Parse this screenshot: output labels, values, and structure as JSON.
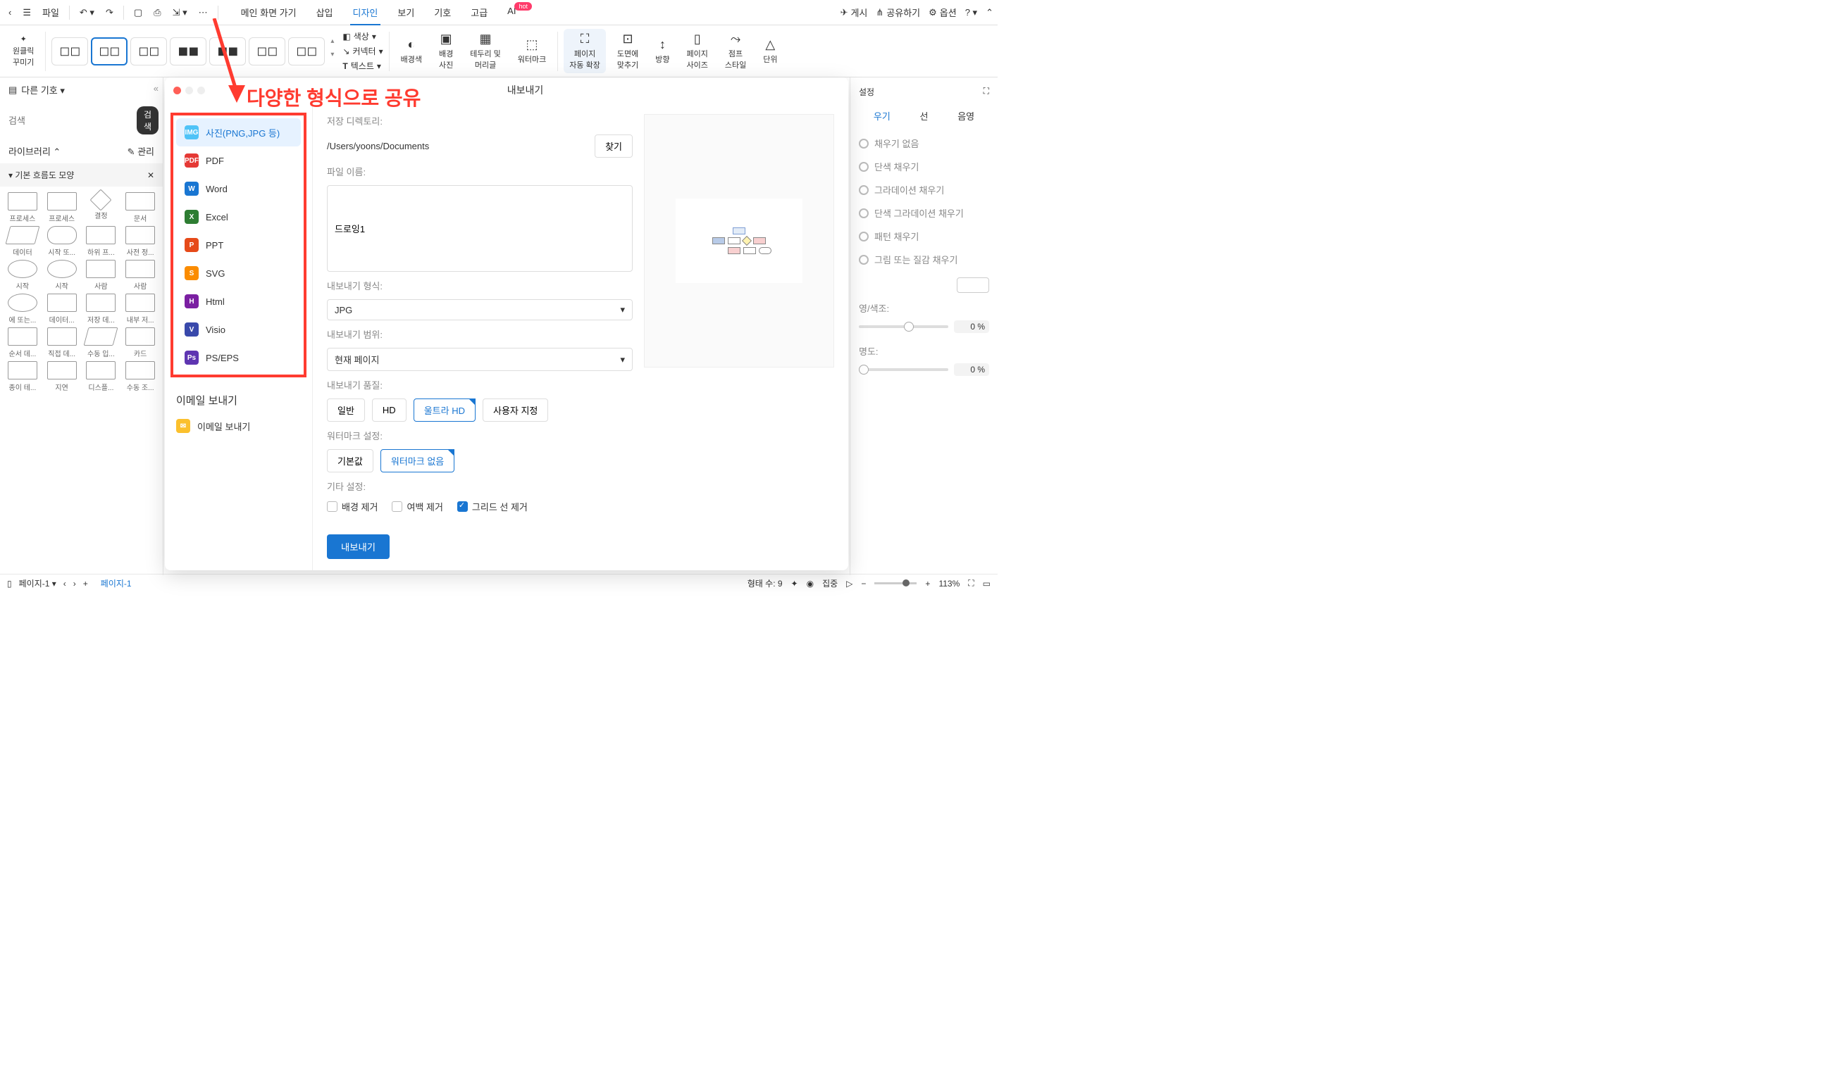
{
  "toolbar": {
    "file": "파일",
    "menus": [
      "메인 화면 가기",
      "삽입",
      "디자인",
      "보기",
      "기호",
      "고급",
      "AI"
    ],
    "active_menu": "디자인",
    "hot": "hot",
    "publish": "게시",
    "share": "공유하기",
    "options": "옵션"
  },
  "ribbon": {
    "oneclick": "원클릭\n꾸미기",
    "mini": {
      "color": "색상",
      "connector": "커넥터",
      "text": "텍스트"
    },
    "bgcolor": "배경색",
    "bgimage": "배경\n사진",
    "border_header": "테두리 및\n머리글",
    "watermark": "워터마크",
    "auto_expand": "페이지\n자동 확장",
    "fit_drawing": "도면에\n맞추기",
    "direction": "방향",
    "page_size": "페이지\n사이즈",
    "jump_style": "점프\n스타일",
    "unit": "단위"
  },
  "left_panel": {
    "other_symbols": "다른 기호",
    "search_ph": "검색",
    "search_btn": "검색",
    "library": "라이브러리",
    "manage": "관리",
    "section": "기본 흐름도 모양",
    "shapes": [
      "프로세스",
      "프로세스",
      "결정",
      "문서",
      "데이터",
      "시작 또...",
      "하위 프...",
      "사전 정...",
      "시작",
      "시작",
      "사람",
      "사람",
      "에 또는...",
      "데이터...",
      "저장 데...",
      "내부 저...",
      "순서 데...",
      "직접 데...",
      "수동 입...",
      "카드",
      "종이 테...",
      "지연",
      "디스플...",
      "수동 조..."
    ]
  },
  "right_panel": {
    "settings": "설정",
    "tabs": {
      "fill": "우기",
      "line": "선",
      "shadow": "음영"
    },
    "fill_opts": [
      "채우기 없음",
      "단색 채우기",
      "그라데이션 채우기",
      "단색 그라데이션 채우기",
      "패턴 채우기",
      "그림 또는 질감 채우기"
    ],
    "tint": "영/색조:",
    "opacity": "명도:",
    "zero": "0 %"
  },
  "dialog": {
    "title": "내보내기",
    "formats": [
      {
        "label": "사진(PNG,JPG 등)",
        "icon": "IMG",
        "color": "#4fc3f7"
      },
      {
        "label": "PDF",
        "icon": "PDF",
        "color": "#e53935"
      },
      {
        "label": "Word",
        "icon": "W",
        "color": "#1976d2"
      },
      {
        "label": "Excel",
        "icon": "X",
        "color": "#2e7d32"
      },
      {
        "label": "PPT",
        "icon": "P",
        "color": "#e64a19"
      },
      {
        "label": "SVG",
        "icon": "S",
        "color": "#fb8c00"
      },
      {
        "label": "Html",
        "icon": "H",
        "color": "#7b1fa2"
      },
      {
        "label": "Visio",
        "icon": "V",
        "color": "#3949ab"
      },
      {
        "label": "PS/EPS",
        "icon": "Ps",
        "color": "#5e35b1"
      }
    ],
    "email_section": "이메일 보내기",
    "email_item": "이메일 보내기",
    "save_dir_label": "저장 디렉토리:",
    "save_dir": "/Users/yoons/Documents",
    "browse": "찾기",
    "filename_label": "파일 이름:",
    "filename": "드로잉1",
    "format_label": "내보내기 형식:",
    "format_val": "JPG",
    "range_label": "내보내기 범위:",
    "range_val": "현재 페이지",
    "quality_label": "내보내기 품질:",
    "quality_opts": [
      "일반",
      "HD",
      "울트라 HD",
      "사용자 지정"
    ],
    "quality_sel": "울트라 HD",
    "wm_label": "워터마크 설정:",
    "wm_opts": [
      "기본값",
      "워터마크 없음"
    ],
    "wm_sel": "워터마크 없음",
    "other_label": "기타 설정:",
    "cb_bg": "배경 제거",
    "cb_margin": "여백 제거",
    "cb_grid": "그리드 선 제거",
    "export_btn": "내보내기"
  },
  "annotation": "다양한 형식으로 공유",
  "status": {
    "page_sel": "페이지-1",
    "page_tab": "페이지-1",
    "shape_count": "형태 수: 9",
    "focus": "집중",
    "zoom": "113%"
  }
}
